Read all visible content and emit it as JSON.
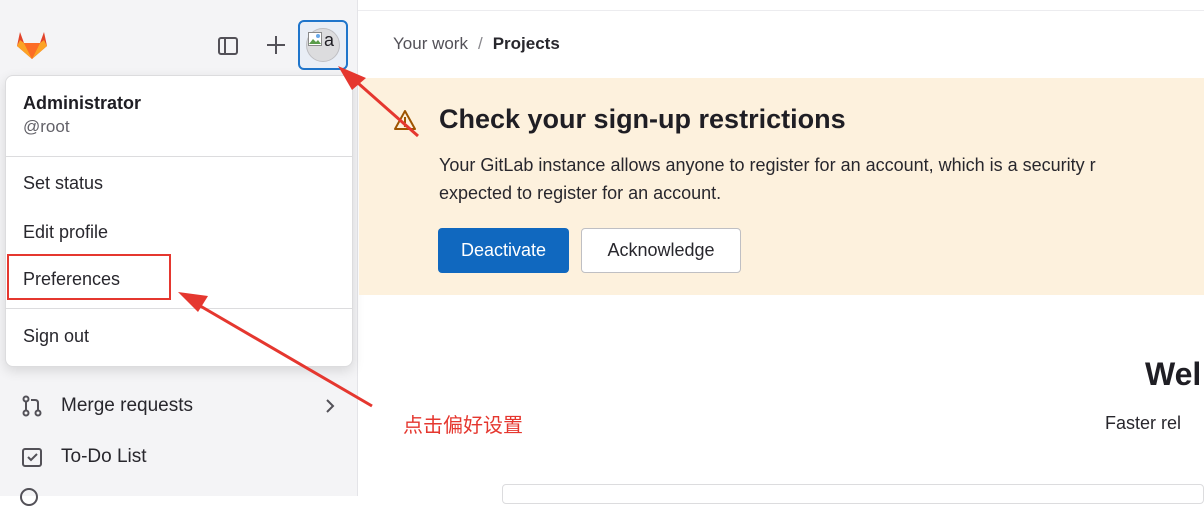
{
  "sidebar": {
    "user_menu": {
      "name": "Administrator",
      "handle": "@root",
      "items": [
        "Set status",
        "Edit profile",
        "Preferences",
        "Sign out"
      ]
    },
    "nav": [
      {
        "label": "Merge requests",
        "icon": "merge-request-icon"
      },
      {
        "label": "To-Do List",
        "icon": "todo-icon"
      }
    ],
    "avatar_alt": "a"
  },
  "breadcrumb": {
    "parent": "Your work",
    "separator": "/",
    "current": "Projects"
  },
  "alert": {
    "title": "Check your sign-up restrictions",
    "body_line1": "Your GitLab instance allows anyone to register for an account, which is a security r",
    "body_line2": "expected to register for an account.",
    "primary_button": "Deactivate",
    "secondary_button": "Acknowledge"
  },
  "main": {
    "welcome_partial": "Wel",
    "subtitle_partial": "Faster rel"
  },
  "annotation": {
    "text": "点击偏好设置",
    "color": "#e5372f"
  },
  "colors": {
    "accent": "#1f75cb",
    "primary_button": "#1068bf",
    "alert_bg": "#fdf1dd",
    "sidebar_bg": "#f4f4f6"
  }
}
